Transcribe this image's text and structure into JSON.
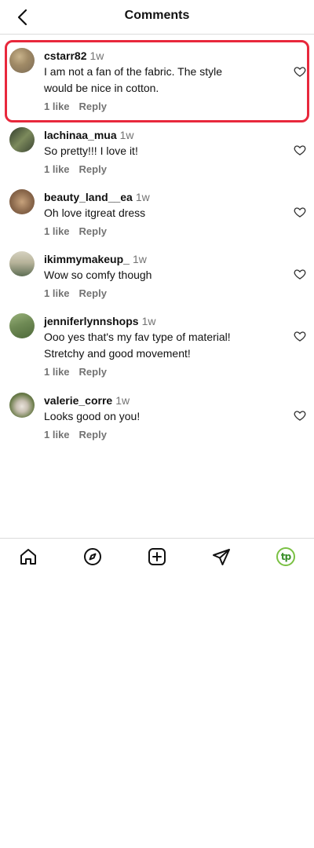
{
  "header": {
    "title": "Comments"
  },
  "comments": [
    {
      "username": "cstarr82",
      "time": "1w",
      "text": "I am not a fan of the fabric. The style would be nice in cotton.",
      "likes": "1 like",
      "reply": "Reply",
      "avatar_colors": [
        "#7a6a55",
        "#c9b48c"
      ]
    },
    {
      "username": "lachinaa_mua",
      "time": "1w",
      "text": "So pretty!!! I love it!⁣",
      "likes": "1 like",
      "reply": "Reply",
      "avatar_colors": [
        "#2f3a2a",
        "#7c8a5c"
      ]
    },
    {
      "username": "beauty_land__ea",
      "time": "1w",
      "text": "Oh love it⁣great dress",
      "likes": "1 like",
      "reply": "Reply",
      "avatar_colors": [
        "#6b4a35",
        "#c7a27c"
      ]
    },
    {
      "username": "ikimmymakeup_",
      "time": "1w",
      "text": "Wow so comfy though",
      "likes": "1 like",
      "reply": "Reply",
      "avatar_colors": [
        "#5e6e54",
        "#d6d2c0"
      ]
    },
    {
      "username": "jenniferlynnshops",
      "time": "1w",
      "text": "Ooo yes that's my fav type of material! Stretchy and good movement!",
      "likes": "1 like",
      "reply": "Reply",
      "avatar_colors": [
        "#4e6a3a",
        "#9ab37b"
      ]
    },
    {
      "username": "valerie_corre",
      "time": "1w",
      "text": "Looks good on you!",
      "likes": "1 like",
      "reply": "Reply",
      "avatar_colors": [
        "#3d4f2c",
        "#e9e4dc"
      ]
    }
  ],
  "tabbar": {
    "items": [
      "home-icon",
      "explore-icon",
      "create-icon",
      "send-icon",
      "profile-icon"
    ],
    "profile_initials": "tp",
    "profile_color": "#7ac143"
  },
  "highlight_color": "#e8283c"
}
